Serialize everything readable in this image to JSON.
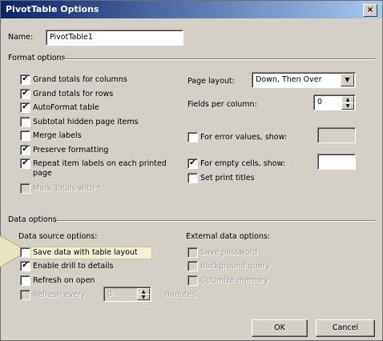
{
  "dialog": {
    "title": "PivotTable Options",
    "close_label": "×"
  },
  "name_field": {
    "label": "Name:",
    "value": "PivotTable1"
  },
  "format_options": {
    "header": "Format options",
    "grand_totals_columns": {
      "label": "Grand totals for columns",
      "checked": true
    },
    "grand_totals_rows": {
      "label": "Grand totals for rows",
      "checked": true
    },
    "autoformat": {
      "label": "AutoFormat table",
      "checked": true
    },
    "subtotal_hidden": {
      "label": "Subtotal hidden page items",
      "checked": false
    },
    "merge_labels": {
      "label": "Merge labels",
      "checked": false
    },
    "preserve_formatting": {
      "label": "Preserve formatting",
      "checked": true
    },
    "repeat_labels": {
      "label_line1": "Repeat item labels on each printed",
      "label_line2": "page",
      "checked": true
    },
    "mark_totals": {
      "label": "Mark Totals with *",
      "checked": false
    },
    "page_layout": {
      "label": "Page layout:",
      "value": "Down, Then Over"
    },
    "fields_per_column": {
      "label": "Fields per column:",
      "value": "0"
    },
    "error_values": {
      "label": "For error values, show:",
      "checked": false,
      "value": ""
    },
    "empty_cells": {
      "label": "For empty cells, show:",
      "checked": true,
      "value": ""
    },
    "print_titles": {
      "label": "Set print titles",
      "checked": false
    }
  },
  "data_options": {
    "header": "Data options",
    "source_header": "Data source options:",
    "save_data": {
      "label": "Save data with table layout",
      "checked": false
    },
    "enable_drill": {
      "label": "Enable drill to details",
      "checked": true
    },
    "refresh_open": {
      "label": "Refresh on open",
      "checked": false
    },
    "refresh_every": {
      "label": "Refresh every",
      "value": "0",
      "unit": "minutes",
      "checked": false
    },
    "external_header": "External data options:",
    "save_password": {
      "label": "Save password",
      "checked": false
    },
    "background_query": {
      "label": "Background query",
      "checked": false
    },
    "optimize_memory": {
      "label": "Optimize memory",
      "checked": false
    }
  },
  "buttons": {
    "ok": "OK",
    "cancel": "Cancel"
  },
  "glyphs": {
    "check": "✔",
    "down_arrow": "▼",
    "up_tri": "▲",
    "down_tri": "▼"
  }
}
